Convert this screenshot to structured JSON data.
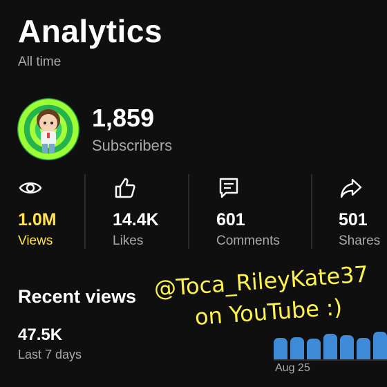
{
  "header": {
    "title": "Analytics",
    "subtitle": "All time"
  },
  "channel": {
    "subscribers_count": "1,859",
    "subscribers_label": "Subscribers"
  },
  "stats": [
    {
      "icon": "eye-icon",
      "value": "1.0M",
      "label": "Views",
      "active": true
    },
    {
      "icon": "thumbs-up-icon",
      "value": "14.4K",
      "label": "Likes",
      "active": false
    },
    {
      "icon": "comment-icon",
      "value": "601",
      "label": "Comments",
      "active": false
    },
    {
      "icon": "share-icon",
      "value": "501",
      "label": "Shares",
      "active": false
    }
  ],
  "recent_views": {
    "title": "Recent views",
    "value": "47.5K",
    "period": "Last 7 days",
    "date_label": "Aug 25",
    "bar_color": "#3f8bd8",
    "bars": [
      0.7,
      0.72,
      0.68,
      0.85,
      0.8,
      0.7,
      0.9
    ]
  },
  "overlay": {
    "line1": "@Toca_RileyKate37",
    "line2": "on YouTube :)",
    "color": "#fff34a"
  },
  "colors": {
    "background": "#0f0f0f",
    "accent": "#ffe14d",
    "muted_text": "#aaaaaa"
  }
}
